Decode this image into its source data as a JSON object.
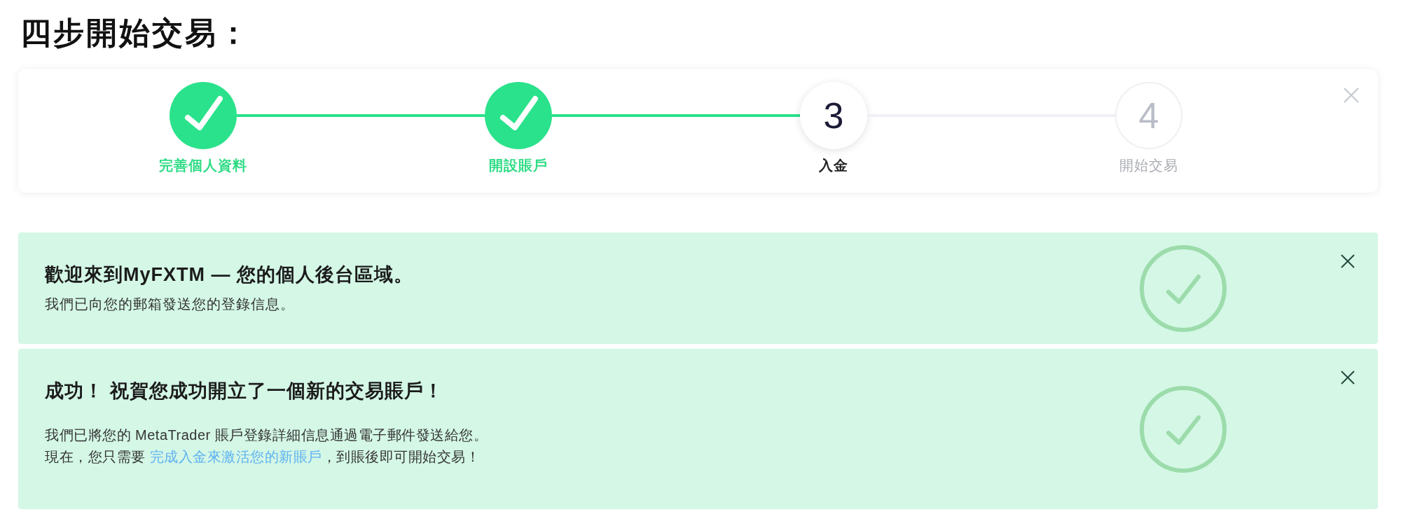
{
  "title": "四步開始交易：",
  "stepper": {
    "steps": [
      {
        "kind": "done",
        "label": "完善個人資料"
      },
      {
        "kind": "done",
        "label": "開設賬戶"
      },
      {
        "kind": "current",
        "number": "3",
        "label": "入金"
      },
      {
        "kind": "upcoming",
        "number": "4",
        "label": "開始交易"
      }
    ]
  },
  "alerts": [
    {
      "heading": "歡迎來到MyFXTM — 您的個人後台區域。",
      "subtitle": "我們已向您的郵箱發送您的登錄信息。"
    },
    {
      "heading": "成功！ 祝賀您成功開立了一個新的交易賬戶！",
      "body": [
        {
          "text": "我們已將您的 MetaTrader 賬戶登錄詳細信息通過電子郵件發送給您。"
        },
        {
          "text": "現在，您只需要 ",
          "link": "完成入金來激活您的新賬戶",
          "after": "，到賬後即可開始交易！"
        }
      ]
    }
  ]
}
